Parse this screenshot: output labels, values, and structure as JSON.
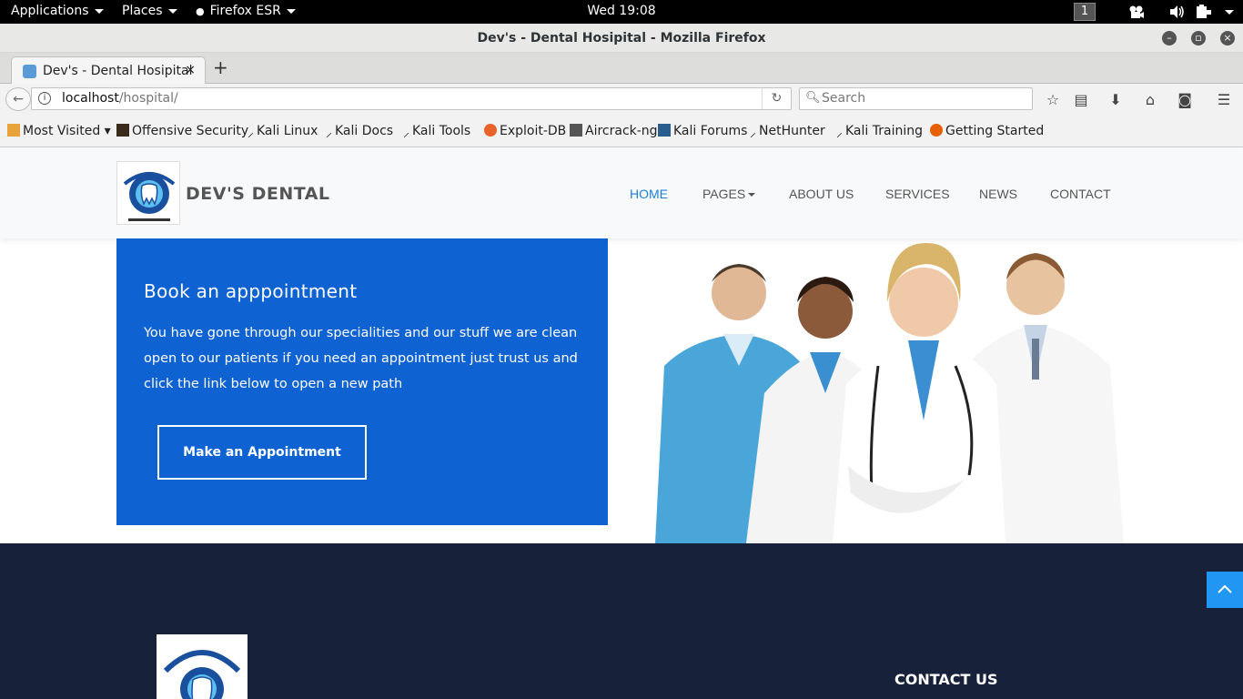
{
  "system_bar": {
    "applications": "Applications",
    "places": "Places",
    "firefox": "Firefox ESR",
    "clock": "Wed 19:08",
    "workspace": "1"
  },
  "window": {
    "title": "Dev's - Dental Hosipital - Mozilla Firefox"
  },
  "tab": {
    "title": "Dev's - Dental Hosipital",
    "close": "×",
    "new_tab": "+"
  },
  "navbar": {
    "url_host": "localhost",
    "url_path": "/hospital/",
    "search_placeholder": "Search"
  },
  "bookmarks": [
    "Most Visited",
    "Offensive Security",
    "Kali Linux",
    "Kali Docs",
    "Kali Tools",
    "Exploit-DB",
    "Aircrack-ng",
    "Kali Forums",
    "NetHunter",
    "Kali Training",
    "Getting Started"
  ],
  "site": {
    "brand": "DEV'S DENTAL",
    "nav": [
      "HOME",
      "PAGES",
      "ABOUT US",
      "SERVICES",
      "NEWS",
      "CONTACT"
    ],
    "accent": "#0f62d1",
    "active_nav_color": "#1c7fd6"
  },
  "booking": {
    "heading": "Book an apppointment",
    "text": "You have gone through our specialities and our stuff we are clean open to our patients if you need an appointment just trust us and click the link below to open a new path",
    "button": "Make an Appointment"
  },
  "footer": {
    "contact_heading": "CONTACT US",
    "bg": "#17223a"
  }
}
